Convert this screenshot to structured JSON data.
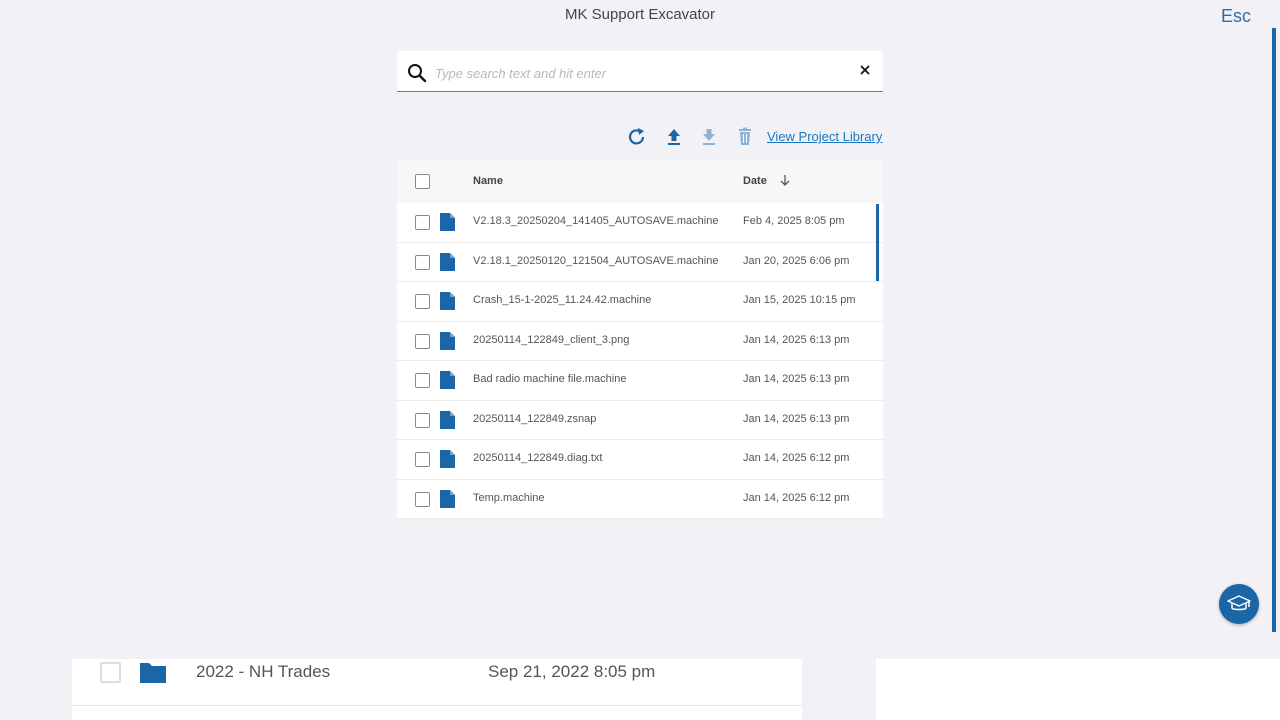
{
  "header": {
    "title": "MK Support Excavator",
    "esc_label": "Esc"
  },
  "search": {
    "placeholder": "Type search text and hit enter",
    "value": ""
  },
  "toolbar": {
    "icons": [
      "refresh-icon",
      "upload-icon",
      "download-icon",
      "trash-icon"
    ],
    "view_library_label": "View Project Library"
  },
  "table": {
    "columns": {
      "name": "Name",
      "date": "Date",
      "sort_icon": "arrow-down-icon"
    },
    "rows": [
      {
        "name": "V2.18.3_20250204_141405_AUTOSAVE.machine",
        "date": "Feb 4, 2025 8:05 pm"
      },
      {
        "name": "V2.18.1_20250120_121504_AUTOSAVE.machine",
        "date": "Jan 20, 2025 6:06 pm"
      },
      {
        "name": "Crash_15-1-2025_11.24.42.machine",
        "date": "Jan 15, 2025 10:15 pm"
      },
      {
        "name": "20250114_122849_client_3.png",
        "date": "Jan 14, 2025 6:13 pm"
      },
      {
        "name": "Bad radio machine file.machine",
        "date": "Jan 14, 2025 6:13 pm"
      },
      {
        "name": "20250114_122849.zsnap",
        "date": "Jan 14, 2025 6:13 pm"
      },
      {
        "name": "20250114_122849.diag.txt",
        "date": "Jan 14, 2025 6:12 pm"
      },
      {
        "name": "Temp.machine",
        "date": "Jan 14, 2025 6:12 pm"
      }
    ]
  },
  "background_list": {
    "rows": [
      {
        "name": "2022 - NH Trades",
        "date": "Sep 21, 2022 8:05 pm",
        "icon": "folder-icon"
      }
    ]
  },
  "help_button": {
    "icon": "graduation-cap-icon"
  },
  "colors": {
    "accent": "#1a66a6",
    "link": "#1a78c2",
    "background": "#f2f2f6"
  }
}
